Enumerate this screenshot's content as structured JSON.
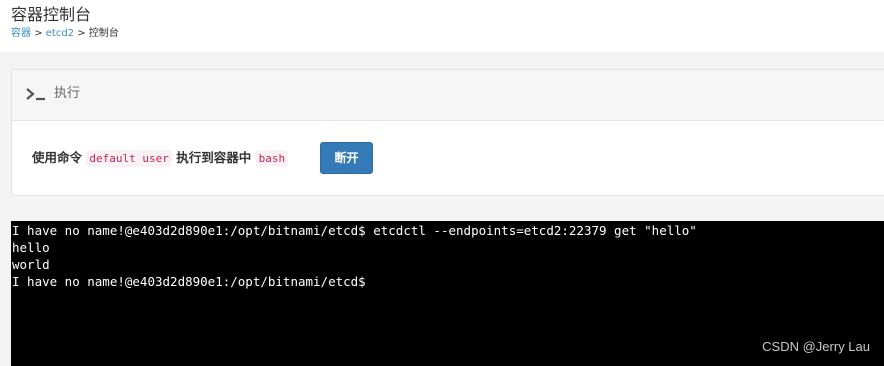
{
  "header": {
    "title": "容器控制台",
    "breadcrumb": [
      {
        "label": "容器"
      },
      {
        "label": "etcd2"
      },
      {
        "label": "控制台"
      }
    ],
    "separator": ">"
  },
  "panel": {
    "icon": "terminal-icon",
    "title": "执行",
    "command_prefix": "使用命令",
    "user_code": "default user",
    "command_middle": "执行到容器中",
    "shell_code": "bash",
    "disconnect_label": "断开"
  },
  "terminal": {
    "lines": [
      "I have no name!@e403d2d890e1:/opt/bitnami/etcd$ etcdctl --endpoints=etcd2:22379 get \"hello\"",
      "hello",
      "world",
      "I have no name!@e403d2d890e1:/opt/bitnami/etcd$"
    ],
    "watermark": "CSDN @Jerry Lau"
  },
  "colors": {
    "link": "#3c8dbc",
    "button": "#337ab7",
    "code_text": "#c7254e",
    "terminal_bg": "#000000"
  }
}
